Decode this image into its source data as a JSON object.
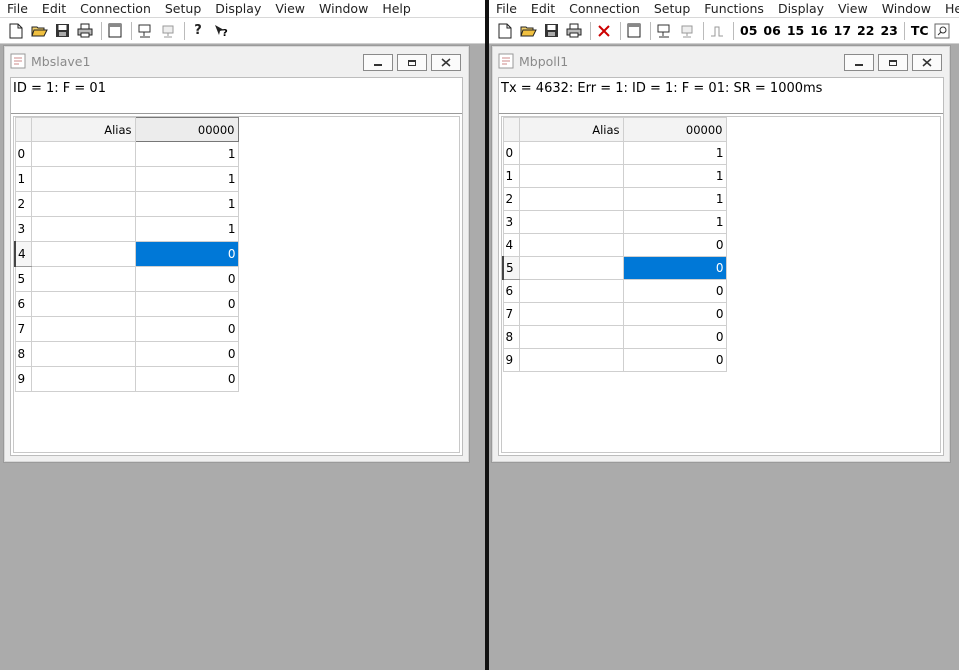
{
  "slave": {
    "menu": [
      "File",
      "Edit",
      "Connection",
      "Setup",
      "Display",
      "View",
      "Window",
      "Help"
    ],
    "window_title": "Mbslave1",
    "status": "ID = 1: F = 01",
    "grid": {
      "alias_header": "Alias",
      "value_header": "00000",
      "rows": [
        {
          "index": "0",
          "alias": "",
          "value": "1"
        },
        {
          "index": "1",
          "alias": "",
          "value": "1"
        },
        {
          "index": "2",
          "alias": "",
          "value": "1"
        },
        {
          "index": "3",
          "alias": "",
          "value": "1"
        },
        {
          "index": "4",
          "alias": "",
          "value": "0"
        },
        {
          "index": "5",
          "alias": "",
          "value": "0"
        },
        {
          "index": "6",
          "alias": "",
          "value": "0"
        },
        {
          "index": "7",
          "alias": "",
          "value": "0"
        },
        {
          "index": "8",
          "alias": "",
          "value": "0"
        },
        {
          "index": "9",
          "alias": "",
          "value": "0"
        }
      ]
    }
  },
  "poll": {
    "menu": [
      "File",
      "Edit",
      "Connection",
      "Setup",
      "Functions",
      "Display",
      "View",
      "Window",
      "Help"
    ],
    "function_buttons": [
      "05",
      "06",
      "15",
      "16",
      "17",
      "22",
      "23"
    ],
    "tc_label": "TC",
    "window_title": "Mbpoll1",
    "status": "Tx = 4632: Err = 1: ID = 1: F = 01: SR = 1000ms",
    "grid": {
      "alias_header": "Alias",
      "value_header": "00000",
      "rows": [
        {
          "index": "0",
          "alias": "",
          "value": "1"
        },
        {
          "index": "1",
          "alias": "",
          "value": "1"
        },
        {
          "index": "2",
          "alias": "",
          "value": "1"
        },
        {
          "index": "3",
          "alias": "",
          "value": "1"
        },
        {
          "index": "4",
          "alias": "",
          "value": "0"
        },
        {
          "index": "5",
          "alias": "",
          "value": "0"
        },
        {
          "index": "6",
          "alias": "",
          "value": "0"
        },
        {
          "index": "7",
          "alias": "",
          "value": "0"
        },
        {
          "index": "8",
          "alias": "",
          "value": "0"
        },
        {
          "index": "9",
          "alias": "",
          "value": "0"
        }
      ]
    }
  },
  "colors": {
    "selection": "#0078d7",
    "workspace": "#ababab",
    "window_title_text": "#8a8a8a"
  },
  "icons": {
    "slave_toolbar": [
      "new-file-icon",
      "open-folder-icon",
      "save-icon",
      "print-icon",
      "window-icon",
      "connect-icon",
      "disconnect-icon",
      "help-icon",
      "context-help-icon"
    ],
    "poll_toolbar": [
      "new-file-icon",
      "open-folder-icon",
      "save-icon",
      "print-icon",
      "close-x-icon",
      "window-icon",
      "connect-icon",
      "disconnect-icon",
      "pulse-icon",
      "tc-icon",
      "search-icon"
    ]
  }
}
